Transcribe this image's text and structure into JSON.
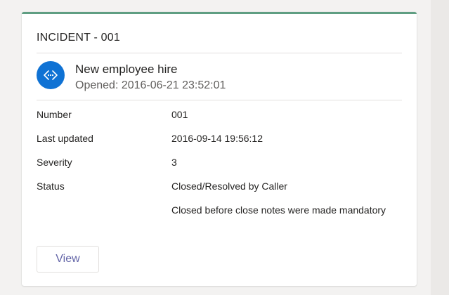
{
  "card": {
    "header": "INCIDENT - 001",
    "icon": "service-incident-icon",
    "title": "New employee hire",
    "subtitle": "Opened: 2016-06-21 23:52:01",
    "accent_color": "#5f9e82",
    "icon_color": "#0f72d4",
    "facts": [
      {
        "label": "Number",
        "value": "001"
      },
      {
        "label": "Last updated",
        "value": "2016-09-14 19:56:12"
      },
      {
        "label": "Severity",
        "value": "3"
      },
      {
        "label": "Status",
        "value": "Closed/Resolved by Caller"
      },
      {
        "label": "",
        "value": "Closed before close notes were made mandatory"
      }
    ],
    "action_label": "View",
    "action_color": "#6264a7"
  }
}
